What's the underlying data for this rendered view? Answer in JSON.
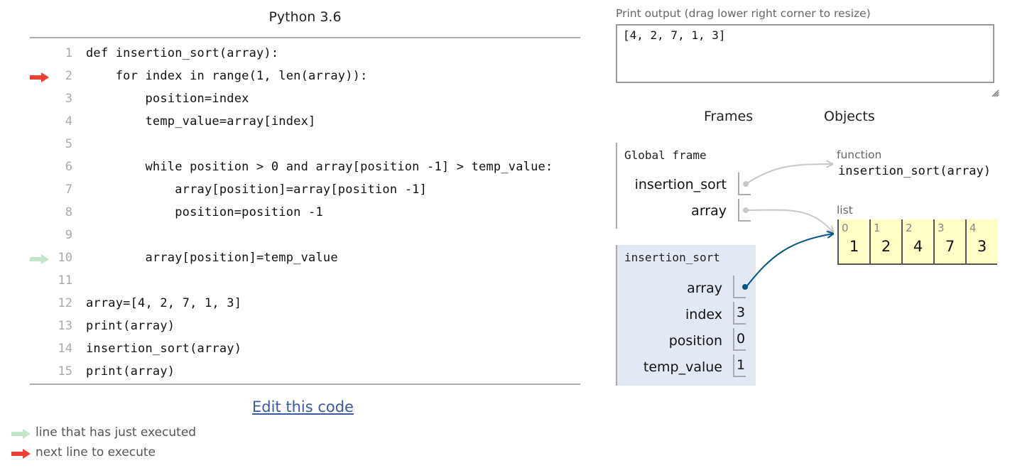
{
  "editor": {
    "language_title": "Python 3.6",
    "lines": [
      {
        "number": "1",
        "code": "def insertion_sort(array):",
        "marker": ""
      },
      {
        "number": "2",
        "code": "    for index in range(1, len(array)):",
        "marker": "next"
      },
      {
        "number": "3",
        "code": "        position=index",
        "marker": ""
      },
      {
        "number": "4",
        "code": "        temp_value=array[index]",
        "marker": ""
      },
      {
        "number": "5",
        "code": "",
        "marker": ""
      },
      {
        "number": "6",
        "code": "        while position > 0 and array[position -1] > temp_value:",
        "marker": ""
      },
      {
        "number": "7",
        "code": "            array[position]=array[position -1]",
        "marker": ""
      },
      {
        "number": "8",
        "code": "            position=position -1",
        "marker": ""
      },
      {
        "number": "9",
        "code": "",
        "marker": ""
      },
      {
        "number": "10",
        "code": "        array[position]=temp_value",
        "marker": "executed"
      },
      {
        "number": "11",
        "code": "",
        "marker": ""
      },
      {
        "number": "12",
        "code": "array=[4, 2, 7, 1, 3]",
        "marker": ""
      },
      {
        "number": "13",
        "code": "print(array)",
        "marker": ""
      },
      {
        "number": "14",
        "code": "insertion_sort(array)",
        "marker": ""
      },
      {
        "number": "15",
        "code": "print(array)",
        "marker": ""
      }
    ],
    "edit_link_label": "Edit this code"
  },
  "legend": {
    "executed_label": "line that has just executed",
    "next_label": "next line to execute"
  },
  "colors": {
    "executed_arrow": "#c5e5c9",
    "next_arrow": "#e93f34",
    "pointer_gray": "#c8c8c8",
    "pointer_active": "#005583",
    "list_bg": "#ffffc6",
    "func_frame_bg": "#e2e9f5",
    "link": "#3d58a2"
  },
  "output": {
    "label": "Print output (drag lower right corner to resize)",
    "text": "[4, 2, 7, 1, 3]"
  },
  "visualization": {
    "frames_header": "Frames",
    "objects_header": "Objects",
    "global_frame": {
      "title": "Global frame",
      "vars": [
        {
          "name": "insertion_sort",
          "value": "",
          "pointer": "function"
        },
        {
          "name": "array",
          "value": "",
          "pointer": "list"
        }
      ]
    },
    "func_frame": {
      "title": "insertion_sort",
      "vars": [
        {
          "name": "array",
          "value": "",
          "pointer": "list"
        },
        {
          "name": "index",
          "value": "3"
        },
        {
          "name": "position",
          "value": "0"
        },
        {
          "name": "temp_value",
          "value": "1"
        }
      ]
    },
    "objects": {
      "function": {
        "type_label": "function",
        "signature": "insertion_sort(array)"
      },
      "list": {
        "type_label": "list",
        "items": [
          {
            "index": "0",
            "value": "1"
          },
          {
            "index": "1",
            "value": "2"
          },
          {
            "index": "2",
            "value": "4"
          },
          {
            "index": "3",
            "value": "7"
          },
          {
            "index": "4",
            "value": "3"
          }
        ]
      }
    }
  }
}
